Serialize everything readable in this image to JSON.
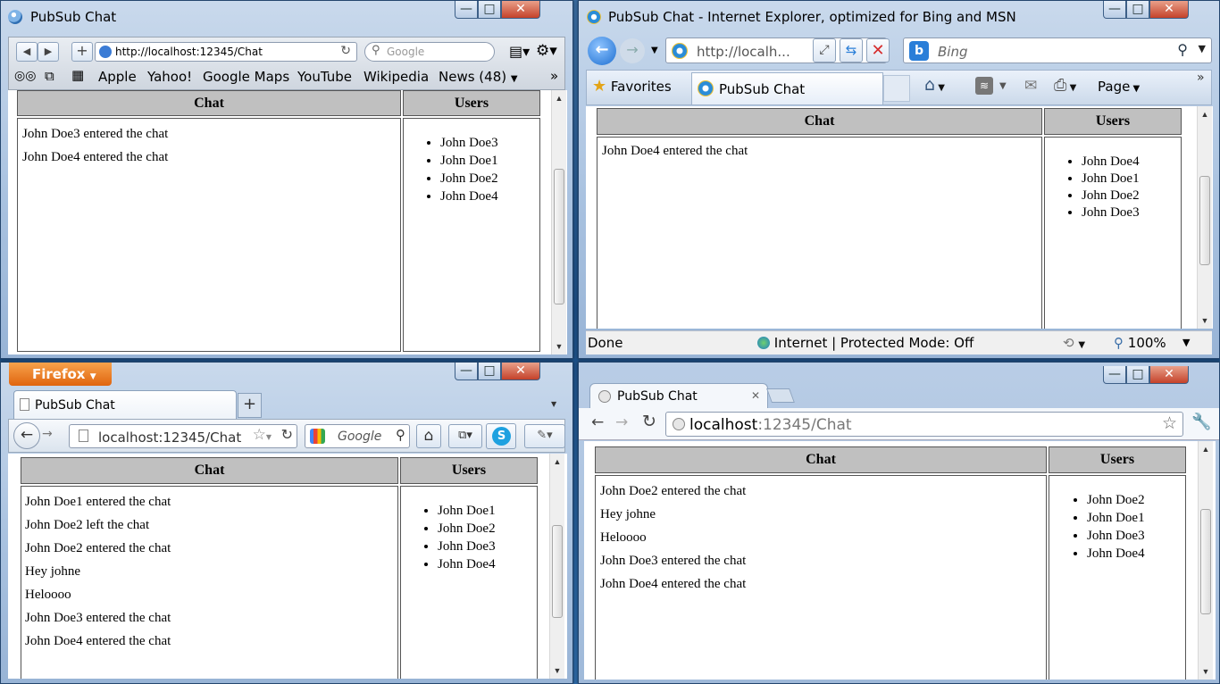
{
  "windows": {
    "safari": {
      "title": "PubSub Chat",
      "url": "http://localhost:12345/Chat",
      "search_placeholder": "Google",
      "bookmarks": [
        "Apple",
        "Yahoo!",
        "Google Maps",
        "YouTube",
        "Wikipedia",
        "News (48)"
      ],
      "chat": {
        "chat_header": "Chat",
        "users_header": "Users",
        "messages": [
          "John Doe3 entered the chat",
          "John Doe4 entered the chat"
        ],
        "users": [
          "John Doe3",
          "John Doe1",
          "John Doe2",
          "John Doe4"
        ]
      }
    },
    "ie": {
      "title": "PubSub Chat - Internet Explorer, optimized for Bing and MSN",
      "url": "http://localh...",
      "search_placeholder": "Bing",
      "favorites_label": "Favorites",
      "tab_label": "PubSub Chat",
      "page_label": "Page",
      "status_done": "Done",
      "status_zone": "Internet | Protected Mode: Off",
      "zoom": "100%",
      "chat": {
        "chat_header": "Chat",
        "users_header": "Users",
        "messages": [
          "John Doe4 entered the chat"
        ],
        "users": [
          "John Doe4",
          "John Doe1",
          "John Doe2",
          "John Doe3"
        ]
      }
    },
    "firefox": {
      "app_button": "Firefox",
      "tab_label": "PubSub Chat",
      "new_tab": "+",
      "url": "localhost:12345/Chat",
      "search_placeholder": "Google",
      "chat": {
        "chat_header": "Chat",
        "users_header": "Users",
        "messages": [
          "John Doe1 entered the chat",
          "John Doe2 left the chat",
          "John Doe2 entered the chat",
          "Hey johne",
          "Heloooo",
          "John Doe3 entered the chat",
          "John Doe4 entered the chat"
        ],
        "users": [
          "John Doe1",
          "John Doe2",
          "John Doe3",
          "John Doe4"
        ]
      }
    },
    "chrome": {
      "tab_label": "PubSub Chat",
      "url_host": "localhost",
      "url_path": ":12345/Chat",
      "chat": {
        "chat_header": "Chat",
        "users_header": "Users",
        "messages": [
          "John Doe2 entered the chat",
          "Hey johne",
          "Heloooo",
          "John Doe3 entered the chat",
          "John Doe4 entered the chat"
        ],
        "users": [
          "John Doe2",
          "John Doe1",
          "John Doe3",
          "John Doe4"
        ]
      }
    }
  },
  "colors": {
    "header_gray": "#c0c0c0",
    "firefox_orange": "#e66000",
    "ie_blue": "#1d6fd1"
  },
  "icons": [
    "globe-icon",
    "back-icon",
    "forward-icon",
    "add-icon",
    "reload-icon",
    "search-icon",
    "page-icon",
    "gear-icon",
    "reader-icon",
    "book-icon",
    "grid-icon",
    "star-icon",
    "home-icon",
    "feed-icon",
    "mail-icon",
    "print-icon",
    "wrench-icon",
    "close-icon"
  ]
}
